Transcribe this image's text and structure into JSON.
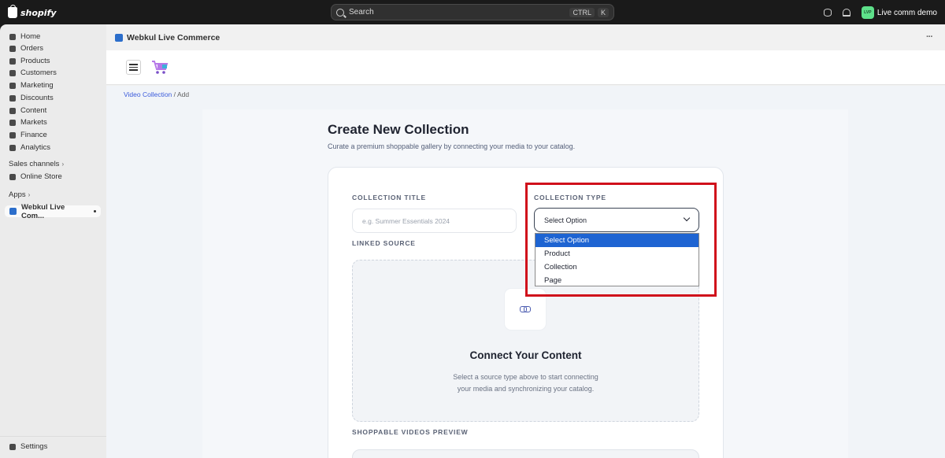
{
  "topbar": {
    "logo_text": "shopify",
    "search_placeholder": "Search",
    "shortcut_key1": "CTRL",
    "shortcut_key2": "K",
    "store_avatar": "LVP",
    "store_name": "Live comm demo"
  },
  "sidebar": {
    "items": [
      {
        "label": "Home",
        "icon": "home-icon"
      },
      {
        "label": "Orders",
        "icon": "orders-icon"
      },
      {
        "label": "Products",
        "icon": "tag-icon"
      },
      {
        "label": "Customers",
        "icon": "person-icon"
      },
      {
        "label": "Marketing",
        "icon": "target-icon"
      },
      {
        "label": "Discounts",
        "icon": "discount-icon"
      },
      {
        "label": "Content",
        "icon": "content-icon"
      },
      {
        "label": "Markets",
        "icon": "globe-icon"
      },
      {
        "label": "Finance",
        "icon": "bank-icon"
      },
      {
        "label": "Analytics",
        "icon": "chart-icon"
      }
    ],
    "sales_channels": "Sales channels",
    "online_store": "Online Store",
    "apps": "Apps",
    "active_app": "Webkul Live Com...",
    "settings": "Settings"
  },
  "app": {
    "title": "Webkul Live Commerce",
    "more": "···"
  },
  "breadcrumb": {
    "link": "Video Collection",
    "separator": "/",
    "current": "Add"
  },
  "page": {
    "title": "Create New Collection",
    "subtitle": "Curate a premium shoppable gallery by connecting your media to your catalog."
  },
  "form": {
    "collection_title_label": "COLLECTION TITLE",
    "collection_title_placeholder": "e.g. Summer Essentials 2024",
    "collection_type_label": "COLLECTION TYPE",
    "collection_type_value": "Select Option",
    "options": [
      "Select Option",
      "Product",
      "Collection",
      "Page"
    ],
    "linked_source_label": "LINKED SOURCE",
    "connect_title": "Connect Your Content",
    "connect_desc_line1": "Select a source type above to start connecting",
    "connect_desc_line2": "your media and synchronizing your catalog.",
    "preview_label": "SHOPPABLE VIDEOS PREVIEW"
  },
  "colors": {
    "highlight": "#d0101b",
    "selected_option": "#1e64d2",
    "link": "#3b5bdb"
  }
}
